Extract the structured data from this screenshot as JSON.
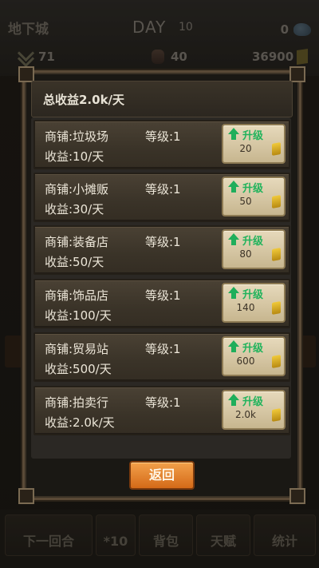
{
  "hud": {
    "location": "地下城",
    "day_label": "DAY",
    "day_number": "10",
    "gems": "0",
    "rank": "71",
    "population": "40",
    "gold": "36900"
  },
  "dialog": {
    "title": "总收益2.0k/天",
    "upgrade_label": "升级",
    "return_label": "返回",
    "shops": [
      {
        "name": "商铺:垃圾场",
        "level": "等级:1",
        "income": "收益:10/天",
        "cost": "20"
      },
      {
        "name": "商铺:小摊贩",
        "level": "等级:1",
        "income": "收益:30/天",
        "cost": "50"
      },
      {
        "name": "商铺:装备店",
        "level": "等级:1",
        "income": "收益:50/天",
        "cost": "80"
      },
      {
        "name": "商铺:饰品店",
        "level": "等级:1",
        "income": "收益:100/天",
        "cost": "140"
      },
      {
        "name": "商铺:贸易站",
        "level": "等级:1",
        "income": "收益:500/天",
        "cost": "600"
      },
      {
        "name": "商铺:拍卖行",
        "level": "等级:1",
        "income": "收益:2.0k/天",
        "cost": "2.0k"
      }
    ]
  },
  "bottom_bar": {
    "next_turn": "下一回合",
    "multiplier": "*10",
    "bag": "背包",
    "talent": "天赋",
    "stats": "统计"
  },
  "colors": {
    "upgrade_text": "#21b35c",
    "return_button": "#e08430",
    "panel_bg": "#3a3328"
  }
}
